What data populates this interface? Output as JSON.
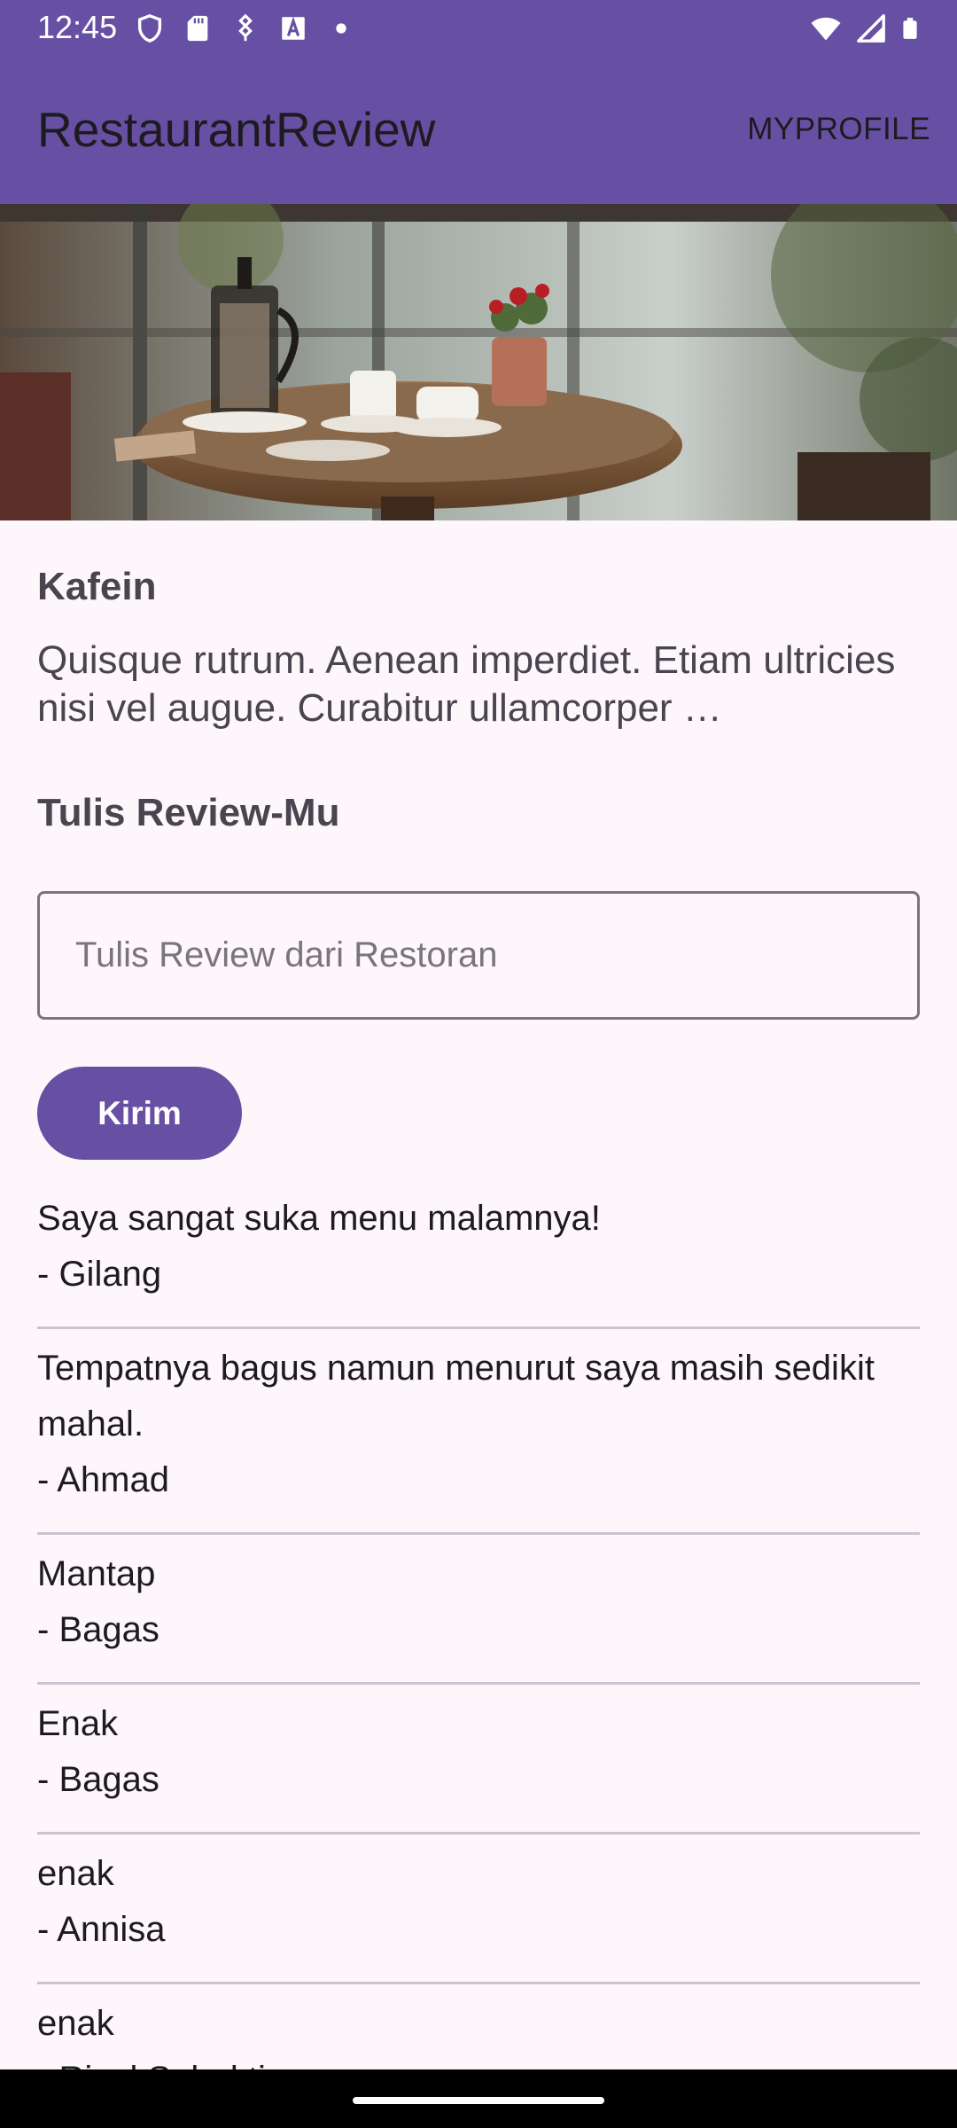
{
  "status_bar": {
    "time": "12:45",
    "left_icons": [
      "shield-icon",
      "sd-card-icon",
      "usb-icon",
      "font-a-icon",
      "dot-icon"
    ],
    "right_icons": [
      "wifi-icon",
      "signal-icon",
      "battery-icon"
    ]
  },
  "app_bar": {
    "title": "RestaurantReview",
    "menu_action": "MYPROFILE"
  },
  "restaurant": {
    "name": "Kafein",
    "description": "Quisque rutrum. Aenean imperdiet. Etiam ultricies nisi vel augue. Curabitur ullamcorper …"
  },
  "review_form": {
    "section_title": "Tulis Review-Mu",
    "input_value": "",
    "input_placeholder": "Tulis Review dari Restoran",
    "send_label": "Kirim"
  },
  "reviews": [
    {
      "text": "Saya sangat suka menu malamnya!",
      "author": "Gilang"
    },
    {
      "text": "Tempatnya bagus namun menurut saya masih sedikit mahal.",
      "author": "Ahmad"
    },
    {
      "text": "Mantap",
      "author": "Bagas"
    },
    {
      "text": "Enak",
      "author": "Bagas"
    },
    {
      "text": "enak",
      "author": "Annisa"
    },
    {
      "text": "enak",
      "author": "Risal Subekti"
    }
  ],
  "colors": {
    "primary": "#6750A4",
    "background": "#FDF7FC",
    "on_surface": "#1D1B20",
    "divider": "#CAC4D0"
  }
}
